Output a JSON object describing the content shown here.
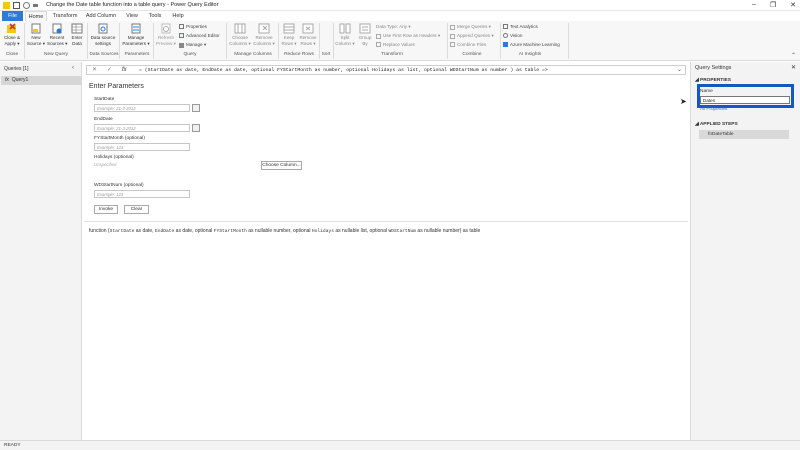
{
  "window": {
    "title": "Change the Date table function into a table query - Power Query Editor",
    "controls": [
      "–",
      "❐",
      "✕"
    ]
  },
  "tabs": [
    "File",
    "Home",
    "Transform",
    "Add Column",
    "View",
    "Tools",
    "Help"
  ],
  "ribbon": {
    "close_apply": "Close &\nApply ▾",
    "new_source": "New\nSource ▾",
    "recent_sources": "Recent\nSources ▾",
    "enter_data": "Enter\nData",
    "data_source_settings": "Data source\nsettings",
    "manage_parameters": "Manage\nParameters ▾",
    "refresh_preview": "Refresh\nPreview ▾",
    "properties": "Properties",
    "advanced_editor": "Advanced Editor",
    "manage": "Manage ▾",
    "choose_columns": "Choose\nColumns ▾",
    "remove_columns": "Remove\nColumns ▾",
    "keep_rows": "Keep\nRows ▾",
    "remove_rows": "Remove\nRows ▾",
    "split_column": "Split\nColumn ▾",
    "group_by": "Group\nBy",
    "data_type": "Data Type: Any ▾",
    "first_row_headers": "Use First Row as Headers ▾",
    "replace_values": "Replace Values",
    "merge_queries": "Merge Queries ▾",
    "append_queries": "Append Queries ▾",
    "combine_files": "Combine Files",
    "text_analytics": "Text Analytics",
    "vision": "Vision",
    "azure_ml": "Azure Machine Learning",
    "groups": [
      "Close",
      "New Query",
      "Data Sources",
      "Parameters",
      "Query",
      "Manage Columns",
      "Reduce Rows",
      "Sort",
      "Transform",
      "Combine",
      "AI Insights"
    ]
  },
  "queries_pane": {
    "title": "Queries [1]",
    "collapse": "‹",
    "items": [
      "Query1"
    ]
  },
  "formula_bar": {
    "cancel": "✕",
    "commit": "✓",
    "fx": "fx",
    "text": "= (StartDate as date, EndDate as date, optional FYStartMonth as number, optional Holidays as list, optional WDStartNum as number ) as table =>",
    "expand": "⌄"
  },
  "params": {
    "heading": "Enter Parameters",
    "start_label": "StartDate",
    "start_ph": "Example: 21-3-2012",
    "end_label": "EndDate",
    "end_ph": "Example: 21-3-2012",
    "fy_label": "FYStartMonth (optional)",
    "fy_ph": "Example: 123",
    "hol_label": "Holidays (optional)",
    "hol_value": "Unspecified",
    "choose_column": "Choose Column...",
    "wd_label": "WDStartNum (optional)",
    "wd_ph": "Example: 123",
    "invoke": "Invoke",
    "clear": "Clear"
  },
  "func_desc": {
    "p1": "function (",
    "a1": "StartDate",
    "p2": " as date, ",
    "a2": "EndDate",
    "p3": " as date, optional ",
    "a3": "FYStartMonth",
    "p4": " as nullable number, optional ",
    "a4": "Holidays",
    "p5": " as nullable list, optional ",
    "a5": "WDStartNum",
    "p6": " as nullable number) as table"
  },
  "query_settings": {
    "title": "Query Settings",
    "close": "✕",
    "properties": "◢ PROPERTIES",
    "name_label": "Name",
    "name_value": "Dates",
    "all_properties": "All Properties",
    "applied_steps": "◢ APPLIED STEPS",
    "steps": [
      "fnDateTable"
    ]
  },
  "status": "READY"
}
